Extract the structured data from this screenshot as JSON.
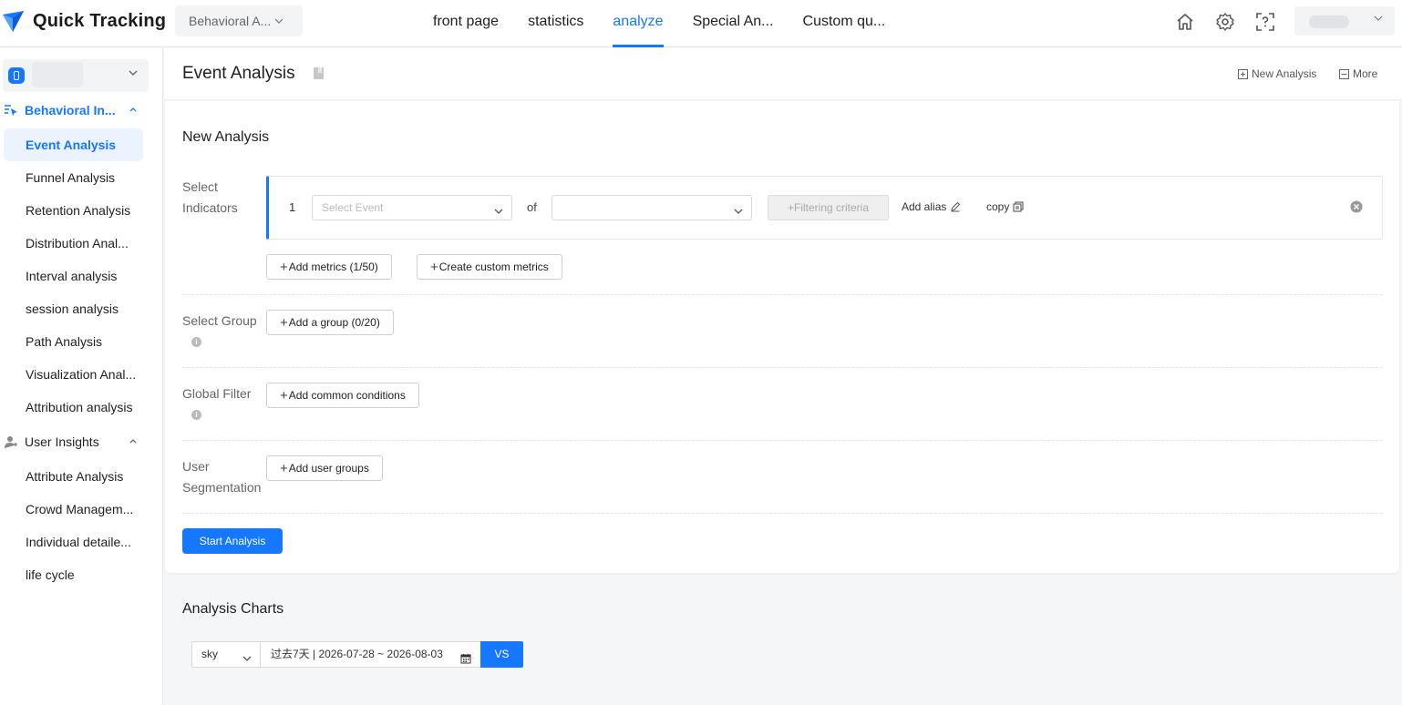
{
  "app": {
    "name": "Quick Tracking",
    "project_selector": "Behavioral A..."
  },
  "nav": {
    "items": [
      {
        "label": "front page"
      },
      {
        "label": "statistics"
      },
      {
        "label": "analyze"
      },
      {
        "label": "Special An..."
      },
      {
        "label": "Custom qu..."
      }
    ],
    "active": "analyze"
  },
  "top_icons": [
    "home-icon",
    "gear-icon",
    "help-scan-icon"
  ],
  "sidebar": {
    "groups": [
      {
        "label": "Behavioral In...",
        "items": [
          {
            "label": "Event Analysis"
          },
          {
            "label": "Funnel Analysis"
          },
          {
            "label": "Retention Analysis"
          },
          {
            "label": "Distribution Anal..."
          },
          {
            "label": "Interval analysis"
          },
          {
            "label": "session analysis"
          },
          {
            "label": "Path Analysis"
          },
          {
            "label": "Visualization Anal..."
          },
          {
            "label": "Attribution analysis"
          }
        ]
      },
      {
        "label": "User Insights",
        "items": [
          {
            "label": "Attribute Analysis"
          },
          {
            "label": "Crowd Managem..."
          },
          {
            "label": "Individual detaile..."
          },
          {
            "label": "life cycle"
          }
        ]
      }
    ],
    "active_item": "Event Analysis"
  },
  "page": {
    "title": "Event Analysis",
    "actions": {
      "new_analysis": "New Analysis",
      "more": "More"
    }
  },
  "form": {
    "title": "New Analysis",
    "select_indicators": {
      "label_line1": "Select",
      "label_line2": "Indicators",
      "metric": {
        "index": "1",
        "event_placeholder": "Select Event",
        "of_label": "of",
        "attribute_placeholder": "",
        "filter_label": "+Filtering criteria",
        "alias_label": "Add alias",
        "copy_label": "copy"
      },
      "add_metrics": "Add metrics (1/50)",
      "create_custom": "Create custom metrics"
    },
    "select_group": {
      "label": "Select Group",
      "button": "Add a group (0/20)"
    },
    "global_filter": {
      "label": "Global Filter",
      "button": "Add common conditions"
    },
    "user_segmentation": {
      "label_line1": "User",
      "label_line2": "Segmentation",
      "button": "Add user groups"
    },
    "start_button": "Start Analysis"
  },
  "charts": {
    "title": "Analysis Charts",
    "compare_select": "sky",
    "date_range": "过去7天 | 2026-07-28 ~ 2026-08-03",
    "vs_button": "VS"
  },
  "colors": {
    "accent": "#1677ff",
    "active_bg": "#eaf3ff"
  }
}
